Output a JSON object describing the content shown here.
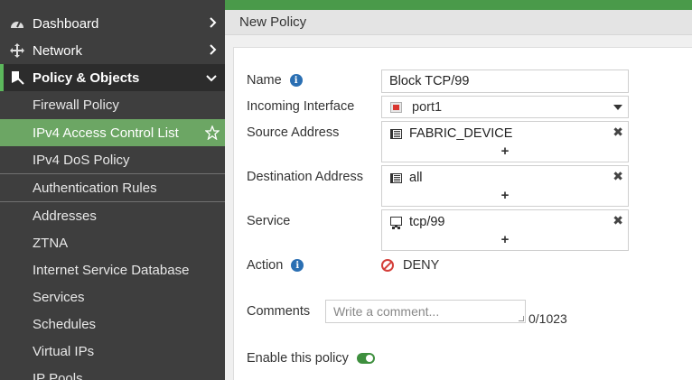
{
  "sidebar": {
    "items": [
      {
        "label": "Dashboard",
        "icon": "dashboard-icon"
      },
      {
        "label": "Network",
        "icon": "network-icon"
      },
      {
        "label": "Policy & Objects",
        "icon": "policy-icon"
      }
    ],
    "subitems": [
      "Firewall Policy",
      "IPv4 Access Control List",
      "IPv4 DoS Policy",
      "Authentication Rules",
      "Addresses",
      "ZTNA",
      "Internet Service Database",
      "Services",
      "Schedules",
      "Virtual IPs",
      "IP Pools"
    ]
  },
  "header": {
    "title": "New Policy"
  },
  "form": {
    "name_label": "Name",
    "name_value": "Block TCP/99",
    "incoming_label": "Incoming Interface",
    "incoming_value": "port1",
    "source_label": "Source Address",
    "source_value": "FABRIC_DEVICE",
    "dest_label": "Destination Address",
    "dest_value": "all",
    "service_label": "Service",
    "service_value": "tcp/99",
    "add_symbol": "+",
    "remove_symbol": "✖",
    "action_label": "Action",
    "action_value": "DENY",
    "comments_label": "Comments",
    "comments_placeholder": "Write a comment...",
    "comments_counter": "0/1023",
    "enable_label": "Enable this policy",
    "enabled": true
  },
  "colors": {
    "accent_green": "#6ca664",
    "topbar_green": "#4a9a4a",
    "deny_red": "#d43f3a",
    "info_blue": "#2a6fb3"
  }
}
